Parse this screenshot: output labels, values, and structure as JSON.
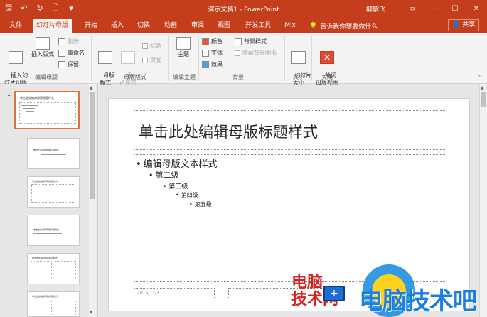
{
  "titlebar": {
    "window_title": "演示文稿1 - PowerPoint",
    "user": "柳紫飞",
    "qat": [
      {
        "icon": "save-icon",
        "glyph": "🖫"
      },
      {
        "icon": "undo-icon",
        "glyph": "↶"
      },
      {
        "icon": "redo-icon",
        "glyph": "↻"
      },
      {
        "icon": "new-file-icon",
        "glyph": "🗋"
      },
      {
        "icon": "customize-icon",
        "glyph": "▾"
      }
    ],
    "controls": [
      {
        "icon": "ribbon-display-icon",
        "glyph": "▭"
      },
      {
        "icon": "minimize-icon",
        "glyph": "—"
      },
      {
        "icon": "maximize-icon",
        "glyph": "☐"
      },
      {
        "icon": "close-icon",
        "glyph": "✕"
      }
    ]
  },
  "tabs": [
    {
      "label": "文件",
      "active": false
    },
    {
      "label": "幻灯片母版",
      "active": true
    },
    {
      "label": "开始",
      "active": false
    },
    {
      "label": "插入",
      "active": false
    },
    {
      "label": "切换",
      "active": false
    },
    {
      "label": "动画",
      "active": false
    },
    {
      "label": "审阅",
      "active": false
    },
    {
      "label": "视图",
      "active": false
    },
    {
      "label": "开发工具",
      "active": false
    },
    {
      "label": "Mix",
      "active": false
    }
  ],
  "tellme": "告诉我你想要做什么",
  "share": "共享",
  "ribbon": {
    "insert_master": "插入幻\n灯片母版",
    "insert_layout": "插入版式",
    "delete": "删除",
    "rename": "重命名",
    "preserve": "保留",
    "group_edit_master": "编辑母版",
    "master_layout": "母版\n版式",
    "insert_placeholder": "插入\n占位符",
    "title_check": "标题",
    "footer_check": "页脚",
    "group_master_layout": "母版版式",
    "themes": "主题",
    "group_edit_theme": "编辑主题",
    "colors": "颜色",
    "fonts": "字体",
    "effects": "效果",
    "background_styles": "背景样式",
    "hide_bg_graphics": "隐藏背景图形",
    "group_background": "背景",
    "slide_size": "幻灯片\n大小",
    "group_size": "大小",
    "close_master": "关闭\n母版视图",
    "group_close": "关闭"
  },
  "thumbnails": {
    "number": "1",
    "title_text": "单击此处编辑母版标题样式"
  },
  "slide": {
    "title": "单击此处编辑母版标题样式",
    "levels": [
      "编辑母版文本样式",
      "第二级",
      "第三级",
      "第四级",
      "第五级"
    ],
    "date": "2016/11/3"
  },
  "watermark": {
    "red_line1": "电脑",
    "red_line2": "技术网",
    "blue": "电脑技术吧",
    "monitor_glyph": "+"
  }
}
